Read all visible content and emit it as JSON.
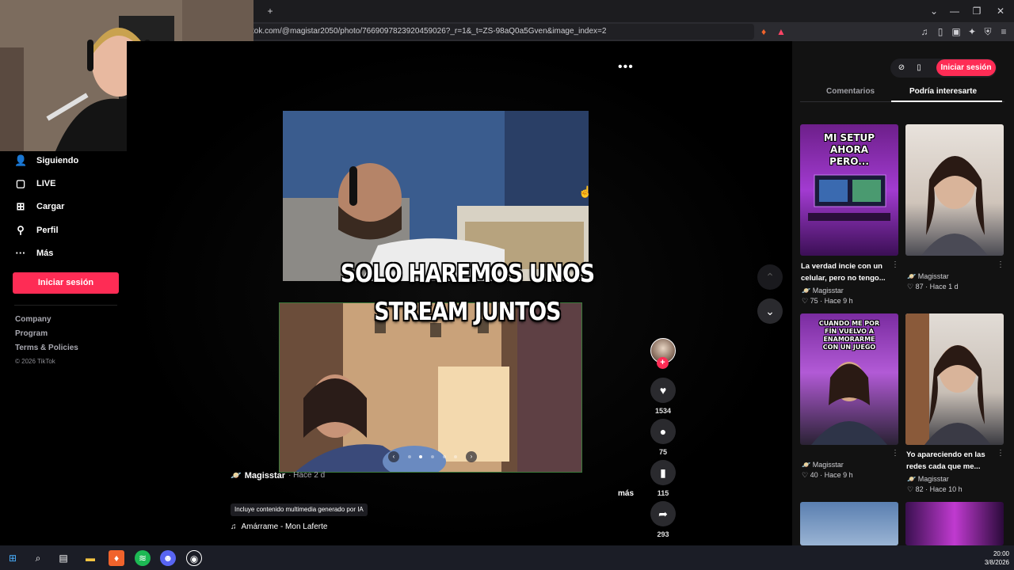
{
  "browser": {
    "new_tab_icon": "+",
    "url": "tok.com/@magistar2050/photo/7669097823920459026?_r=1&_t=ZS-98aQ0a5Gven&image_index=2",
    "window_controls": [
      "⌄",
      "—",
      "❐",
      "✕"
    ]
  },
  "sidebar": {
    "items": [
      {
        "label": "Siguiendo",
        "icon": "people-icon"
      },
      {
        "label": "LIVE",
        "icon": "live-icon"
      },
      {
        "label": "Cargar",
        "icon": "upload-icon"
      },
      {
        "label": "Perfil",
        "icon": "profile-icon"
      },
      {
        "label": "Más",
        "icon": "more-icon"
      }
    ],
    "login_label": "Iniciar sesión",
    "footer_links": [
      "Company",
      "Program",
      "Terms & Policies"
    ],
    "copyright": "© 2026 TikTok"
  },
  "post": {
    "caption_line1": "SOLO HAREMOS UNOS",
    "caption_line2": "STREAM JUNTOS",
    "author": "Magisstar",
    "time": "· Hace 2 d",
    "more_label": "más",
    "ai_badge": "Incluye contenido multimedia generado por IA",
    "music": "Amárrame - Mon Laferte",
    "carousel_total": 5,
    "carousel_active": 2
  },
  "actions": {
    "likes": "1534",
    "comments": "75",
    "saves": "115",
    "shares": "293"
  },
  "right_panel": {
    "login_label": "Iniciar sesión",
    "tabs": [
      "Comentarios",
      "Podría interesarte"
    ],
    "cards": [
      {
        "thumb_text": "MI SETUP AHORA PERO...",
        "desc1": "La verdad incie con un",
        "desc2": "celular, pero no tengo...",
        "author": "Magisstar",
        "likes": "75",
        "time": "Hace 9 h"
      },
      {
        "thumb_text": "",
        "desc1": "",
        "desc2": "",
        "author": "Magisstar",
        "likes": "87",
        "time": "Hace 1 d"
      },
      {
        "thumb_text": "CUANDO ME POR FÍN VUELVO A ENAMORARME CON UN JUEGO",
        "desc1": "",
        "desc2": "",
        "author": "Magisstar",
        "likes": "40",
        "time": "Hace 9 h"
      },
      {
        "thumb_text": "",
        "desc1": "Yo apareciendo en las",
        "desc2": "redes cada que me...",
        "author": "Magisstar",
        "likes": "82",
        "time": "Hace 10 h"
      }
    ]
  },
  "taskbar": {
    "time": "20:00",
    "date": "3/8/2026"
  },
  "colors": {
    "brand_pink": "#fe2c55",
    "background": "#000000",
    "panel": "#121212"
  }
}
